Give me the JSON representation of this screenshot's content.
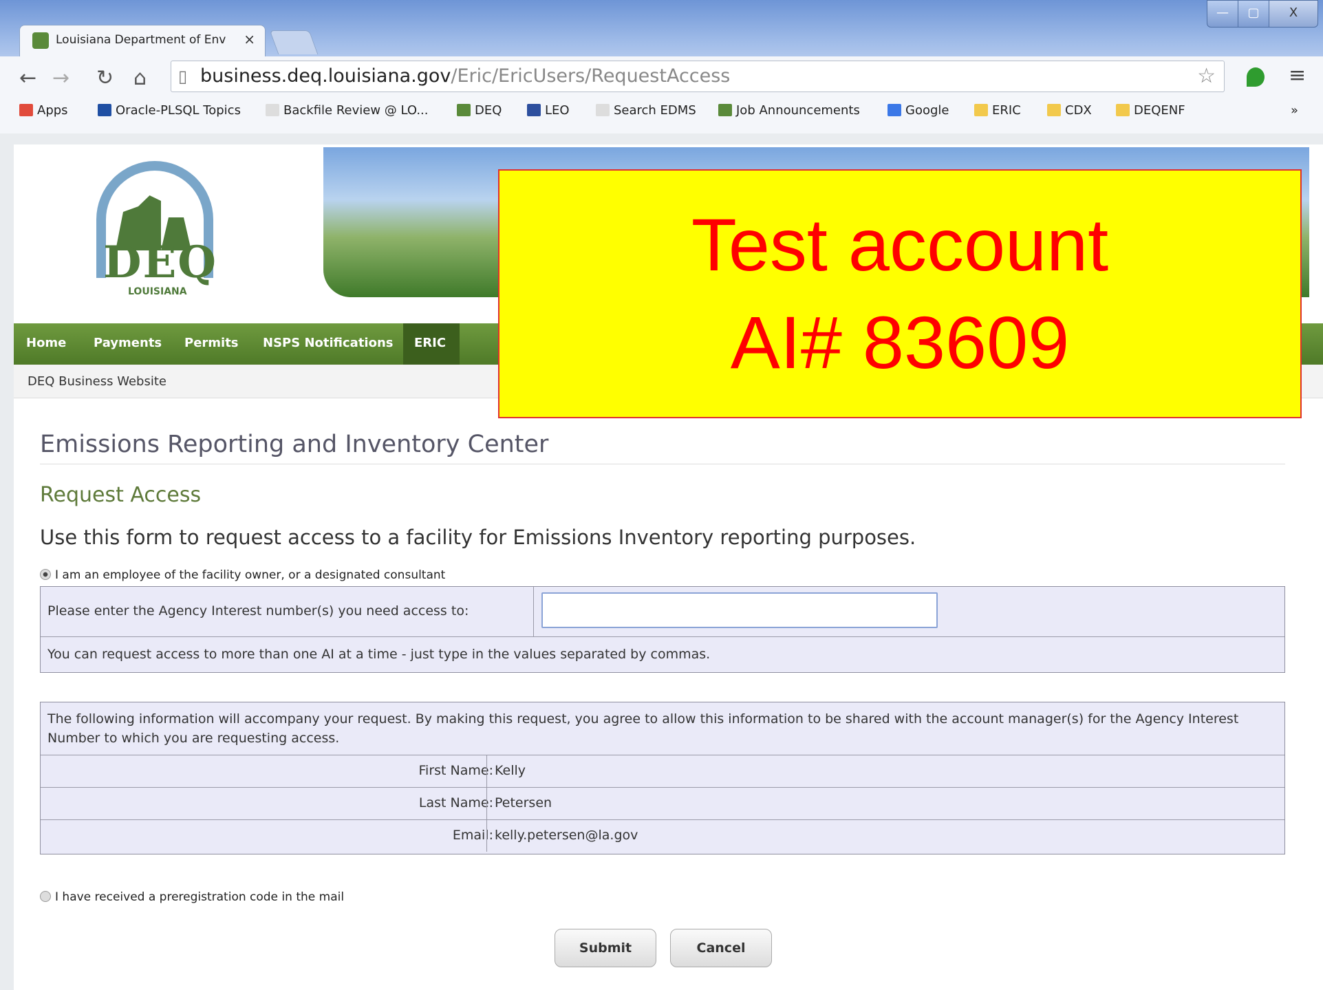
{
  "browser": {
    "tab_title": "Louisiana Department of Env",
    "tab_close": "×",
    "window_controls": [
      "—",
      "▢",
      "X"
    ],
    "url_host": "business.deq.louisiana.gov",
    "url_path": "/Eric/EricUsers/RequestAccess",
    "nav_icons": [
      "back-icon",
      "forward-icon",
      "reload-icon",
      "home-icon"
    ],
    "bookmarks": [
      {
        "label": "Apps",
        "icon": "apps-grid-icon",
        "color": "#e14b3b"
      },
      {
        "label": "Oracle-PLSQL Topics",
        "icon": "t-icon",
        "color": "#1f4fa3"
      },
      {
        "label": "Backfile Review @ LO...",
        "icon": "page-icon",
        "color": "#dddddd"
      },
      {
        "label": "DEQ",
        "icon": "deq-icon",
        "color": "#5a8a3a"
      },
      {
        "label": "LEO",
        "icon": "leo-icon",
        "color": "#2d4f9e"
      },
      {
        "label": "Search EDMS",
        "icon": "page-icon",
        "color": "#dddddd"
      },
      {
        "label": "Job Announcements",
        "icon": "deq-icon",
        "color": "#5a8a3a"
      },
      {
        "label": "Google",
        "icon": "google-icon",
        "color": "#3b78e7"
      },
      {
        "label": "ERIC",
        "icon": "folder-icon",
        "color": "#f2c94c"
      },
      {
        "label": "CDX",
        "icon": "folder-icon",
        "color": "#f2c94c"
      },
      {
        "label": "DEQENF",
        "icon": "folder-icon",
        "color": "#f2c94c"
      }
    ],
    "bookmarks_more": "»"
  },
  "site": {
    "logo_text": "DEQ",
    "logo_subtext": "LOUISIANA",
    "nav": [
      "Home",
      "Payments",
      "Permits",
      "NSPS Notifications",
      "ERIC"
    ],
    "breadcrumb": "DEQ Business Website"
  },
  "overlay": {
    "line1": "Test account",
    "line2": "AI# 83609"
  },
  "page": {
    "title": "Emissions Reporting and Inventory Center",
    "subtitle": "Request Access",
    "intro": "Use this form to request access to a facility for Emissions Inventory reporting purposes.",
    "option_employee": "I am an employee of the facility owner, or a designated consultant",
    "ai_label": "Please enter the Agency Interest number(s) you need access to:",
    "ai_value": "",
    "ai_hint": "You can request access to more than one AI at a time - just type in the values separated by commas.",
    "info_lead": "The following information will accompany your request. By making this request, you agree to allow this information to be shared with the account manager(s) for the Agency Interest Number to which you are requesting access.",
    "fields": [
      {
        "label": "First Name:",
        "value": "Kelly"
      },
      {
        "label": "Last Name:",
        "value": "Petersen"
      },
      {
        "label": "Email:",
        "value": "kelly.petersen@la.gov"
      }
    ],
    "option_preregistration": "I have received a preregistration code in the mail",
    "submit": "Submit",
    "cancel": "Cancel"
  }
}
